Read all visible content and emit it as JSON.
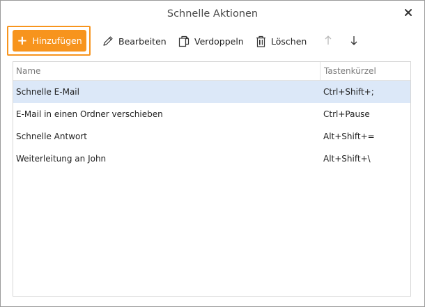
{
  "window": {
    "title": "Schnelle Aktionen"
  },
  "toolbar": {
    "add_label": "Hinzufügen",
    "edit_label": "Bearbeiten",
    "duplicate_label": "Verdoppeln",
    "delete_label": "Löschen",
    "accent_color": "#f7941d"
  },
  "table": {
    "columns": {
      "name": "Name",
      "shortcut": "Tastenkürzel"
    },
    "rows": [
      {
        "name": "Schnelle E-Mail",
        "shortcut": "Ctrl+Shift+;",
        "selected": true
      },
      {
        "name": "E-Mail in einen Ordner verschieben",
        "shortcut": "Ctrl+Pause",
        "selected": false
      },
      {
        "name": "Schnelle Antwort",
        "shortcut": "Alt+Shift+=",
        "selected": false
      },
      {
        "name": "Weiterleitung an John",
        "shortcut": "Alt+Shift+\\",
        "selected": false
      }
    ],
    "selected_color": "#dce8f8"
  }
}
